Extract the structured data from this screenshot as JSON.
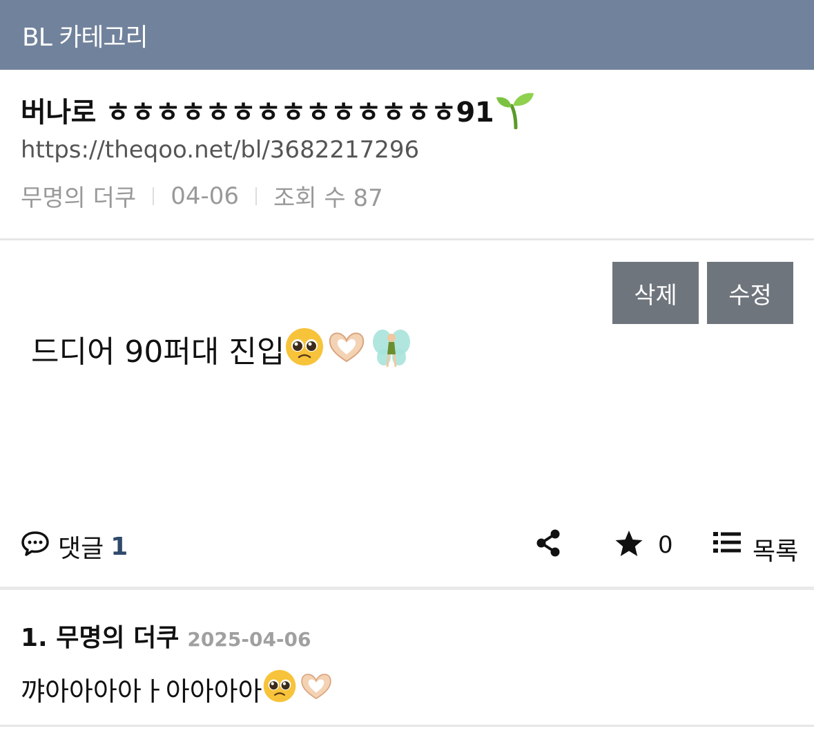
{
  "header": {
    "category": "BL 카테고리"
  },
  "post": {
    "title": "버나로 ㅎㅎㅎㅎㅎㅎㅎㅎㅎㅎㅎㅎㅎㅎ91",
    "url": "https://theqoo.net/bl/3682217296",
    "author": "무명의 더쿠",
    "date": "04-06",
    "views": "조회 수 87",
    "body": "드디어 90퍼대 진입"
  },
  "buttons": {
    "delete": "삭제",
    "edit": "수정"
  },
  "footer": {
    "comment_label": "댓글",
    "comment_count": "1",
    "star_count": "0",
    "list_label": "목록"
  },
  "comments": [
    {
      "author": "1. 무명의 더쿠",
      "date": "2025-04-06",
      "text": "꺄아아아아ㅏ아아아아"
    }
  ],
  "colors": {
    "topbar": "#71829c",
    "button": "#6f757d",
    "count_accent": "#2f4a6a"
  },
  "icons": [
    "sprout-icon",
    "pleading-face-icon",
    "heart-hands-icon",
    "fairy-icon",
    "speech-bubble-icon",
    "share-icon",
    "star-icon",
    "list-icon"
  ]
}
